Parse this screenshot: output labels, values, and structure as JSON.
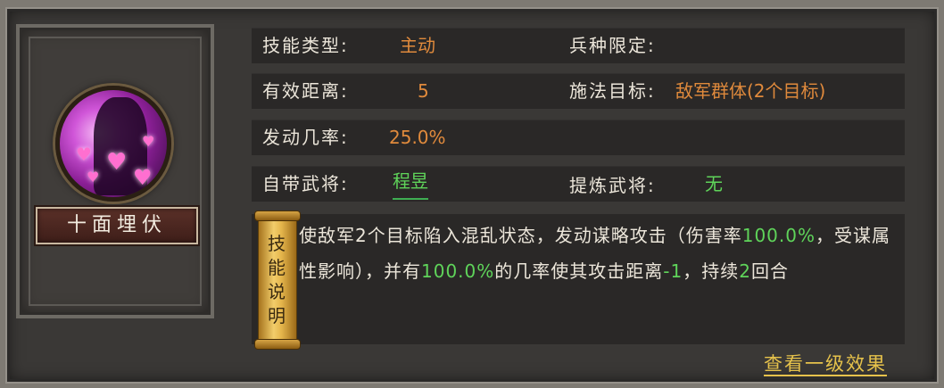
{
  "skill": {
    "name": "十面埋伏",
    "icon": "purple-hearts-skill-icon"
  },
  "attributes": {
    "skill_type_label": "技能类型:",
    "skill_type_value": "主动",
    "troop_limit_label": "兵种限定:",
    "troop_limit_value": "",
    "range_label": "有效距离:",
    "range_value": "5",
    "target_label": "施法目标:",
    "target_value": "敌军群体(2个目标)",
    "chance_label": "发动几率:",
    "chance_value": "25.0%",
    "innate_hero_label": "自带武将:",
    "innate_hero_value": "程昱",
    "refine_hero_label": "提炼武将:",
    "refine_hero_value": "无"
  },
  "description": {
    "scroll_label_chars": [
      "技",
      "能",
      "说",
      "明"
    ],
    "segments": [
      {
        "text": "使敌军2个目标陷入混乱状态，发动谋略攻击（伤害率",
        "color": "normal"
      },
      {
        "text": "100.0%",
        "color": "green"
      },
      {
        "text": "，受谋属性影响），并有",
        "color": "normal"
      },
      {
        "text": "100.0%",
        "color": "green"
      },
      {
        "text": "的几率使其攻击距离",
        "color": "normal"
      },
      {
        "text": "-1",
        "color": "green"
      },
      {
        "text": "，持续",
        "color": "normal"
      },
      {
        "text": "2",
        "color": "green"
      },
      {
        "text": "回合",
        "color": "normal"
      }
    ]
  },
  "footer": {
    "view_level_one_effect": "查看一级效果"
  },
  "colors": {
    "value_orange": "#e08a3c",
    "value_green": "#5fd45a",
    "link_gold": "#e6c24b",
    "panel_bg": "#2a2827"
  }
}
